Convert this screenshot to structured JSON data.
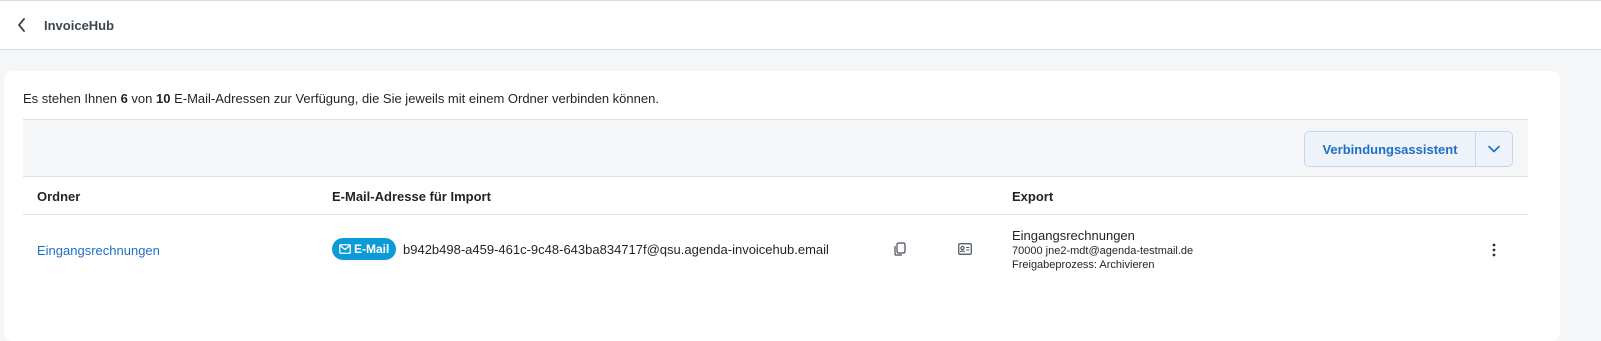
{
  "header": {
    "app_title": "InvoiceHub",
    "back_icon": "chevron-left-icon"
  },
  "intro": {
    "prefix": "Es stehen Ihnen ",
    "used": "6",
    "middle": " von ",
    "total": "10",
    "suffix": " E-Mail-Adressen zur Verfügung, die Sie jeweils mit einem Ordner verbinden können."
  },
  "toolbar": {
    "assistant_label": "Verbindungsassistent",
    "dropdown_icon": "chevron-down-icon"
  },
  "table": {
    "columns": [
      "Ordner",
      "E-Mail-Adresse für Import",
      "Export"
    ],
    "rows": [
      {
        "folder": "Eingangsrechnungen",
        "badge_label": "E-Mail",
        "email": "b942b498-a459-461c-9c48-643ba834717f@qsu.agenda-invoicehub.email",
        "export_title": "Eingangsrechnungen",
        "export_line1": "70000 jne2-mdt@agenda-testmail.de",
        "export_line2": "Freigabeprozess: Archivieren"
      }
    ]
  },
  "colors": {
    "accent": "#1f6fc6",
    "badge": "#0d9bd8",
    "background": "#f5f6f8"
  }
}
